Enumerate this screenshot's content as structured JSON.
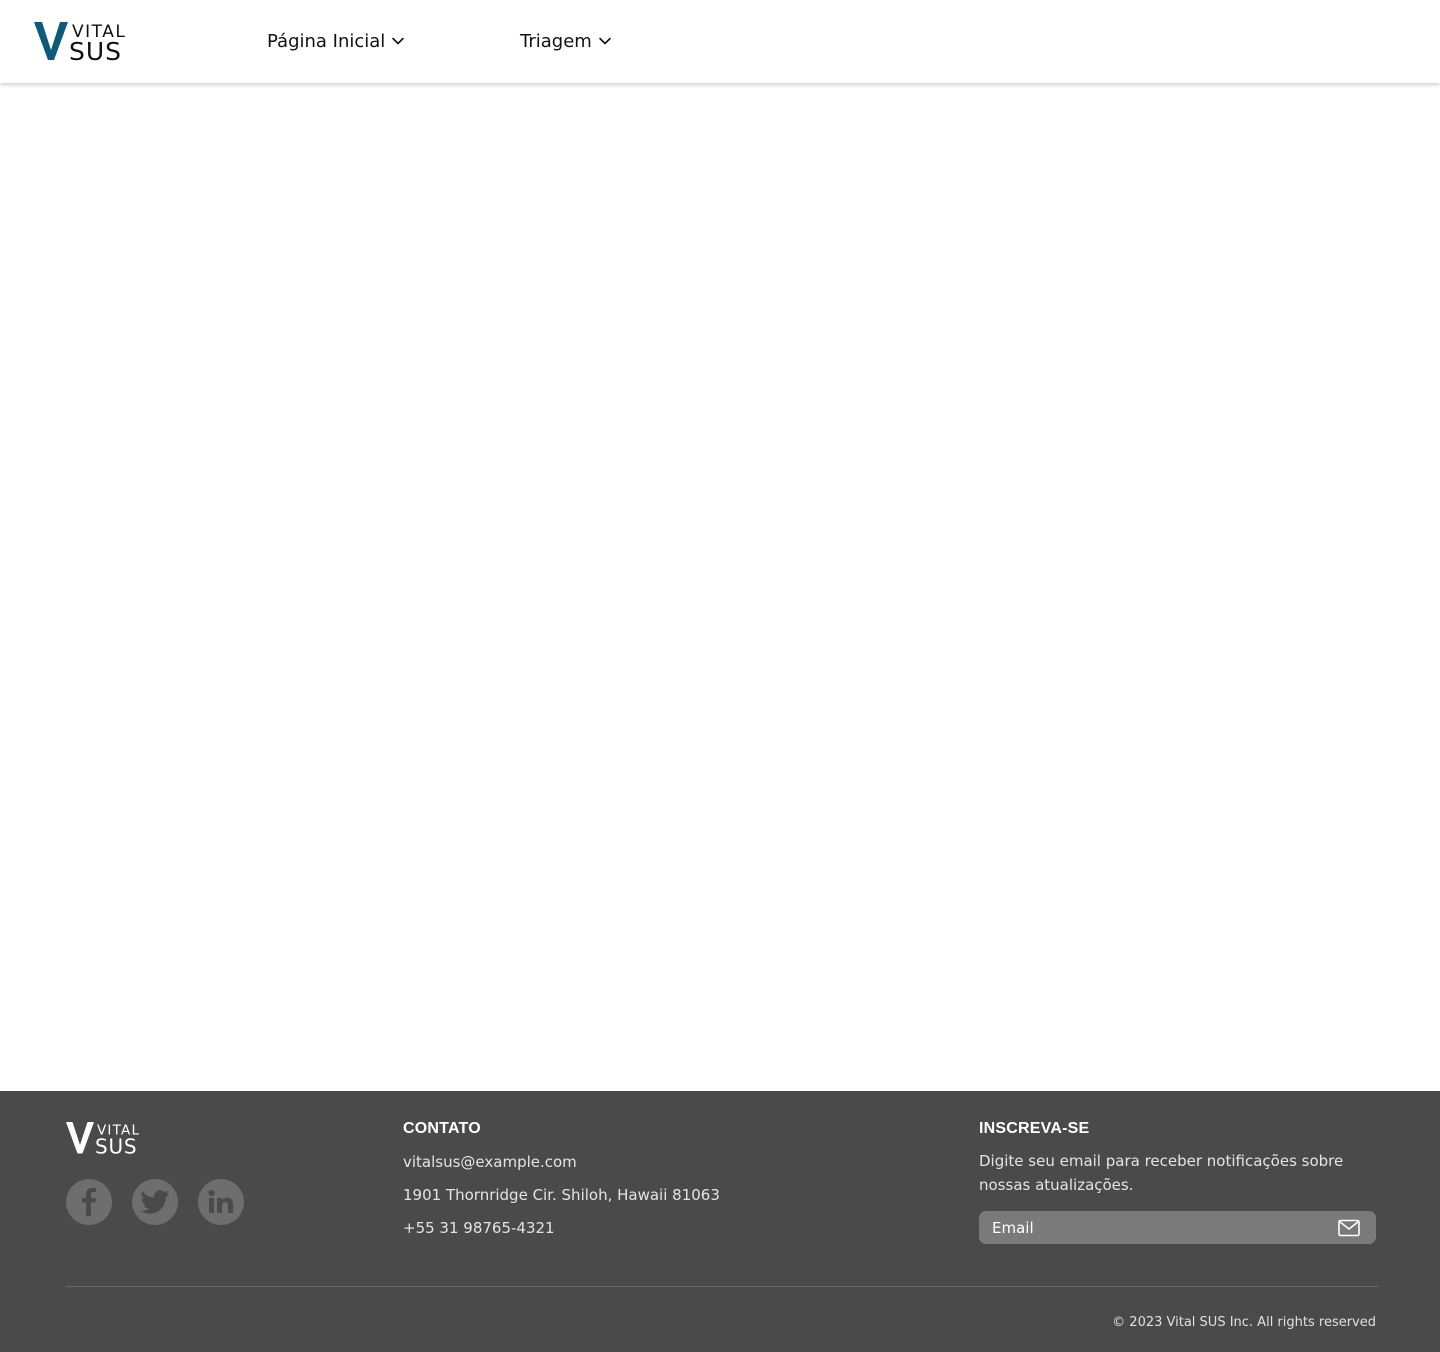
{
  "brand": {
    "logo_top": "VITAL",
    "logo_bottom": "SUS",
    "logo_primary_color": "#0e5a78",
    "logo_text_color": "#111111"
  },
  "nav": {
    "items": [
      {
        "label": "Página Inicial",
        "icon": "chevron-down-icon"
      },
      {
        "label": "Triagem",
        "icon": "chevron-down-icon"
      }
    ]
  },
  "footer": {
    "background": "#4a4a4a",
    "social": [
      {
        "name": "facebook",
        "icon": "facebook-icon"
      },
      {
        "name": "twitter",
        "icon": "twitter-icon"
      },
      {
        "name": "linkedin",
        "icon": "linkedin-icon"
      }
    ],
    "contact": {
      "title": "CONTATO",
      "email": "vitalsus@example.com",
      "address": "1901 Thornridge Cir. Shiloh, Hawaii 81063",
      "phone": "+55 31 98765-4321"
    },
    "subscribe": {
      "title": "INSCREVA-SE",
      "description": "Digite seu email para receber notificações sobre nossas atualizações.",
      "email_placeholder": "Email",
      "submit_icon": "mail-icon"
    },
    "copyright": "© 2023 Vital SUS Inc. All rights reserved"
  }
}
